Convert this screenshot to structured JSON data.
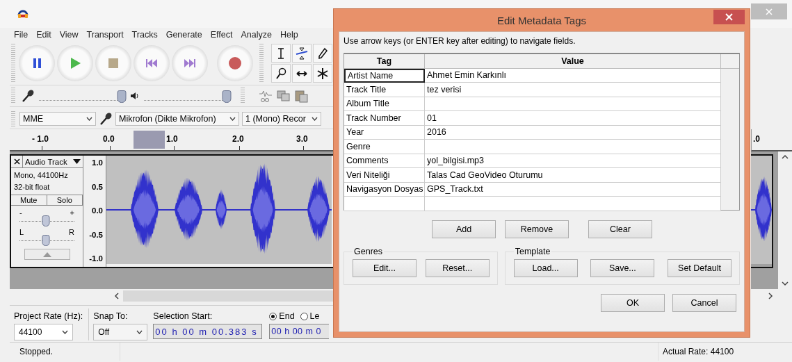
{
  "menu": [
    "File",
    "Edit",
    "View",
    "Transport",
    "Tracks",
    "Generate",
    "Effect",
    "Analyze",
    "Help"
  ],
  "meters": {
    "record_slider": {
      "level": 0.95
    },
    "playback_slider": {
      "level": 0.95
    }
  },
  "device_bar": {
    "host": "MME",
    "input_device": "Mikrofon (Dikte Mikrofon)",
    "channels": "1 (Mono) Recor"
  },
  "ruler": {
    "ticks": [
      "- 1.0",
      "0.0",
      "1.0",
      "2.0",
      "3.0"
    ],
    "edge_tick": ".0"
  },
  "track": {
    "name": "Audio Track",
    "info": [
      "Mono, 44100Hz",
      "32-bit float"
    ],
    "mute": "Mute",
    "solo": "Solo",
    "gain": {
      "minus": "-",
      "plus": "+",
      "level": 0.48
    },
    "pan": {
      "left": "L",
      "right": "R",
      "level": 0.48
    },
    "scale": [
      "1.0",
      "0.5",
      "0.0",
      "-0.5",
      "-1.0"
    ]
  },
  "selection_bar": {
    "project_rate_label": "Project Rate (Hz):",
    "project_rate": "44100",
    "snap_label": "Snap To:",
    "snap": "Off",
    "selection_start_label": "Selection Start:",
    "selection_start": "00 h 00 m 00.383 s",
    "radios": [
      {
        "label": "End",
        "selected": true
      },
      {
        "label": "Le",
        "selected": false
      }
    ],
    "selection_end": "00 h 00 m 0"
  },
  "status_bar": {
    "state": "Stopped.",
    "rate": "Actual Rate: 44100"
  },
  "dialog": {
    "title": "Edit Metadata Tags",
    "hint": "Use arrow keys (or ENTER key after editing) to navigate fields.",
    "columns": [
      "Tag",
      "Value"
    ],
    "rows": [
      {
        "tag": "Artist Name",
        "value": "Ahmet Emin Karkınlı",
        "selected": true
      },
      {
        "tag": "Track Title",
        "value": "tez verisi",
        "selected": false
      },
      {
        "tag": "Album Title",
        "selected": false
      },
      {
        "tag": "Track Number",
        "value": "01",
        "selected": false
      },
      {
        "tag": "Year",
        "value": "2016",
        "selected": false
      },
      {
        "tag": "Genre",
        "selected": false
      },
      {
        "tag": "Comments",
        "value": "yol_bilgisi.mp3",
        "selected": false
      },
      {
        "tag": "Veri Niteliği",
        "value": "Talas Cad GeoVideo Oturumu",
        "selected": false
      },
      {
        "tag": "Navigasyon Dosyas",
        "value": "GPS_Track.txt",
        "selected": false
      }
    ],
    "buttons": [
      "Add",
      "Remove",
      "Clear"
    ],
    "genres": {
      "title": "Genres",
      "buttons": [
        "Edit...",
        "Reset..."
      ]
    },
    "template": {
      "title": "Template",
      "buttons": [
        "Load...",
        "Save...",
        "Set Default"
      ]
    },
    "footer_buttons": [
      "OK",
      "Cancel"
    ]
  }
}
